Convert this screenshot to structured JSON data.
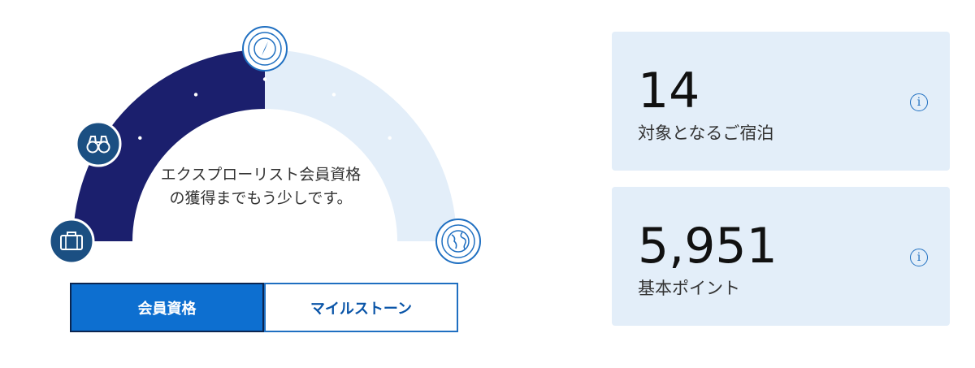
{
  "gauge": {
    "progress": 0.5,
    "message": "エクスプローリスト会員資格の獲得までもう少しです。",
    "colors": {
      "filled": "#1b1f6d",
      "unfilled": "#e3eef9",
      "accent": "#1f6fc1"
    },
    "tier_icons": [
      "briefcase-icon",
      "binoculars-icon",
      "compass-icon",
      "globe-icon"
    ]
  },
  "toggle": {
    "active": "会員資格",
    "inactive": "マイルストーン"
  },
  "stats": [
    {
      "value": "14",
      "label": "対象となるご宿泊",
      "info": "i"
    },
    {
      "value": "5,951",
      "label": "基本ポイント",
      "info": "i"
    }
  ]
}
